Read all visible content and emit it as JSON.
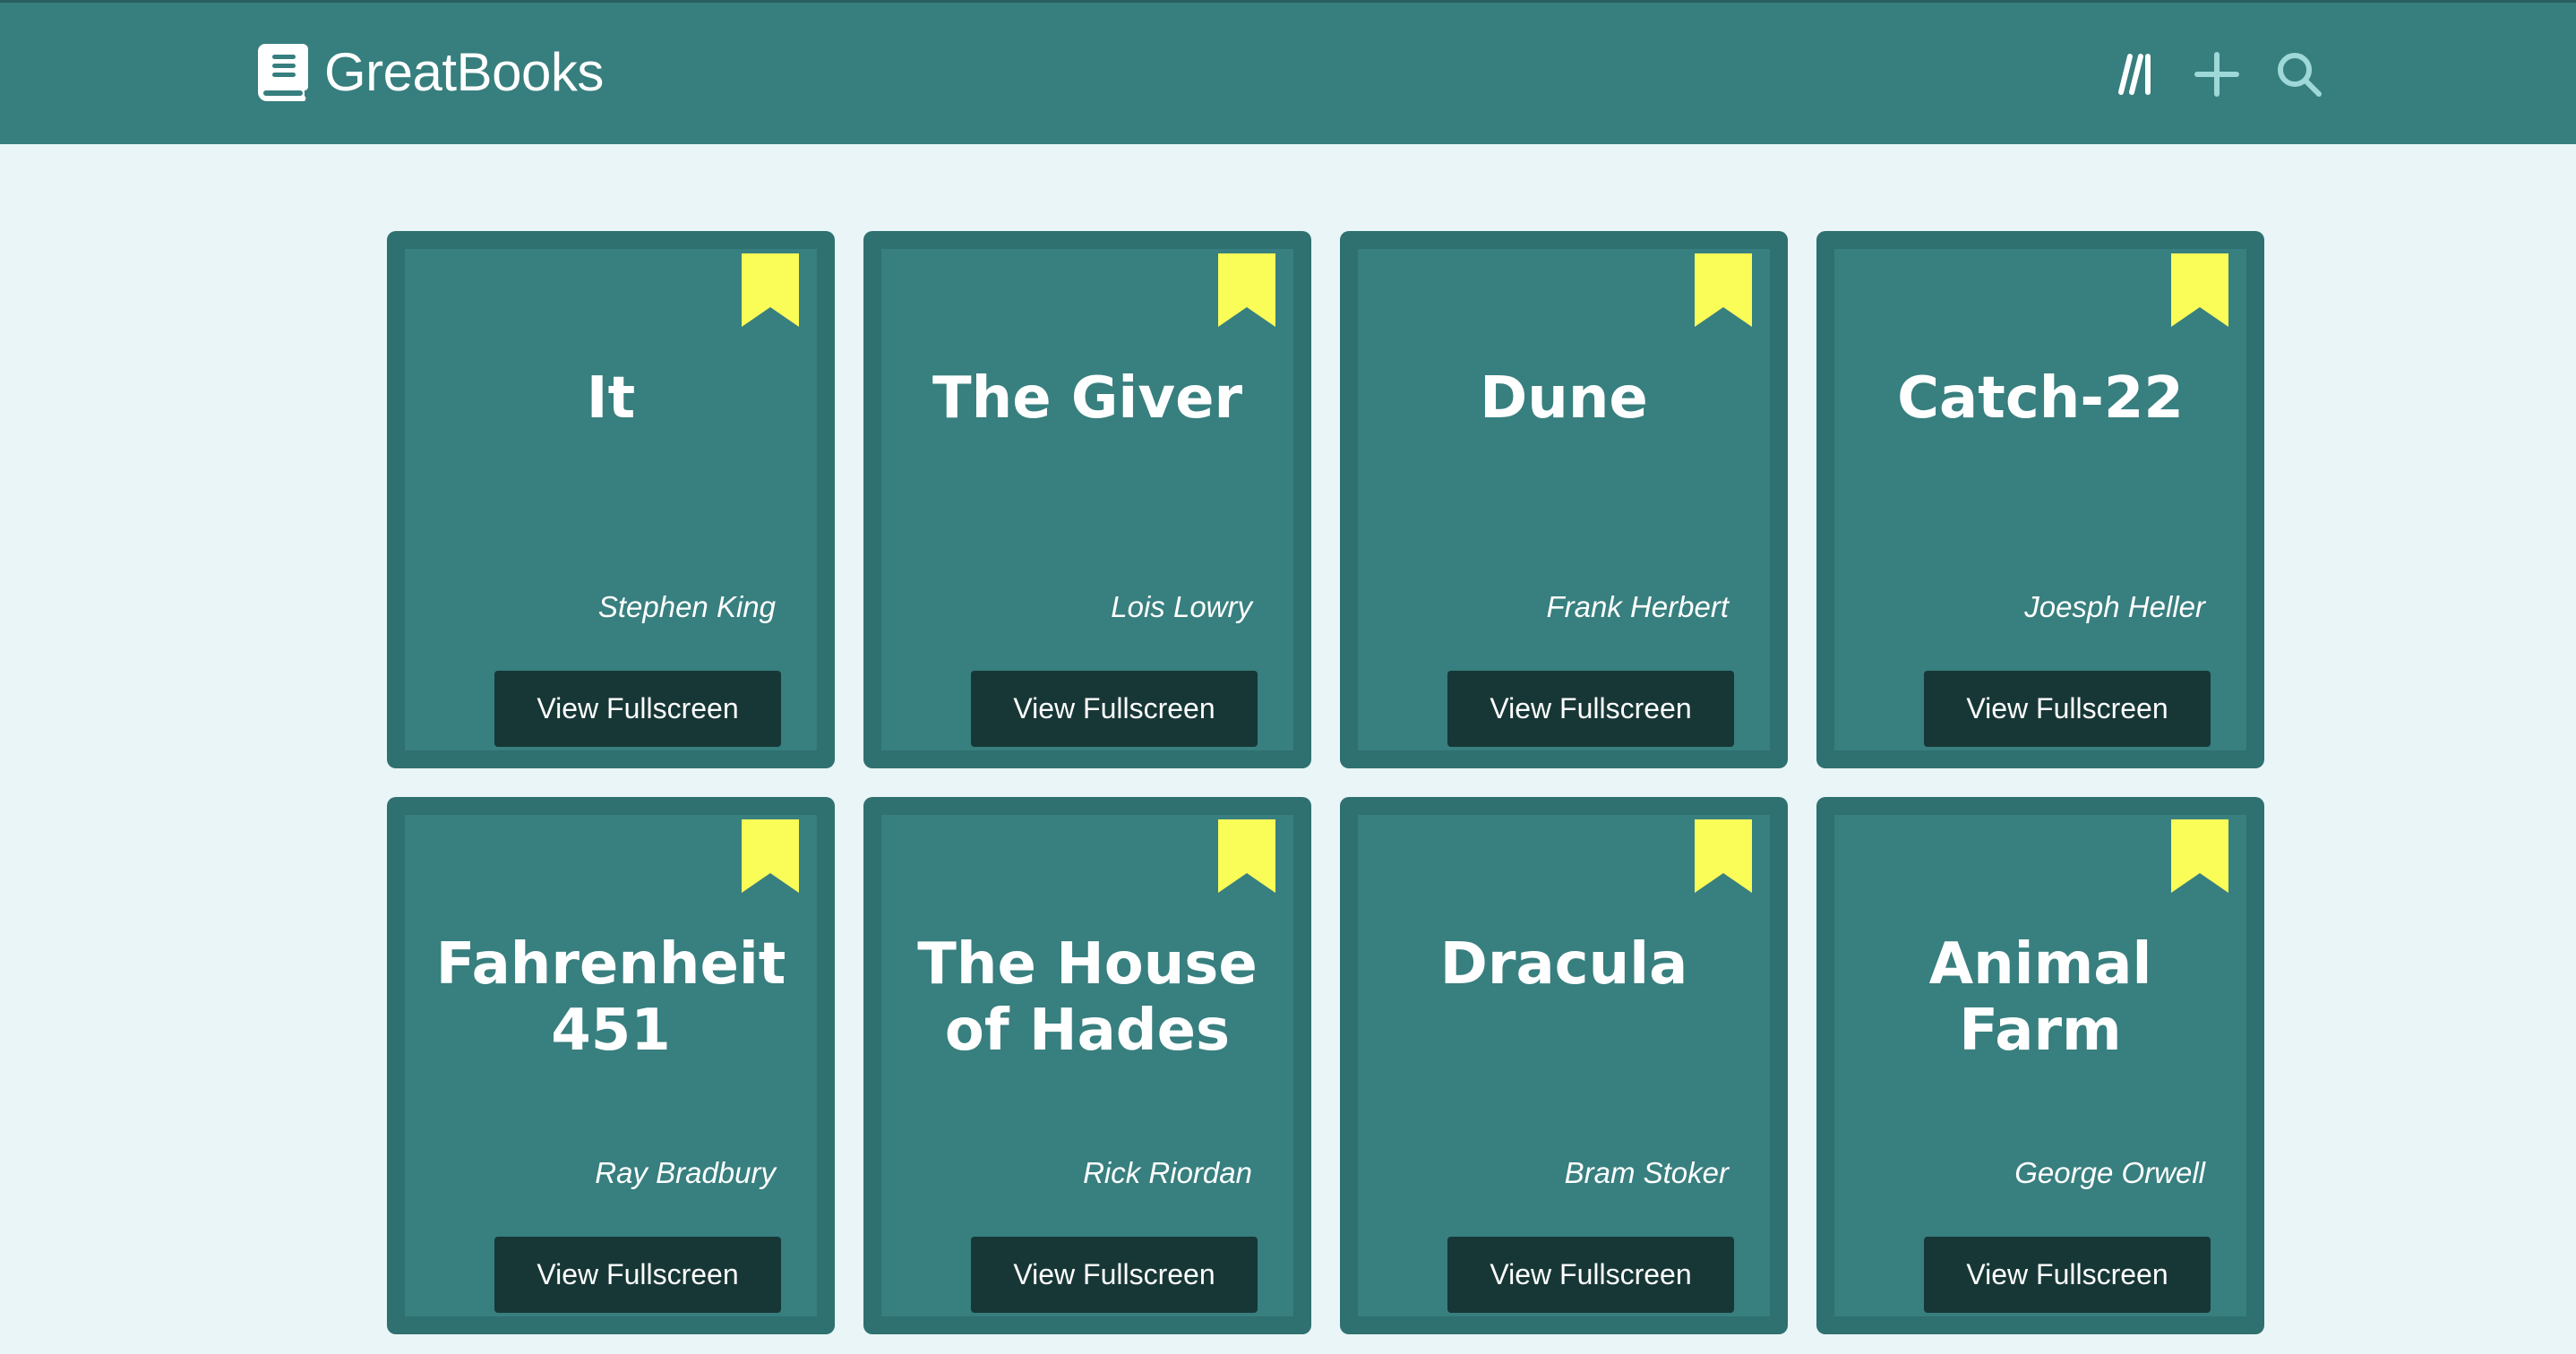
{
  "app": {
    "name": "GreatBooks",
    "icons": [
      "book-icon",
      "library-icon",
      "plus-icon",
      "search-icon"
    ]
  },
  "colors": {
    "navbar": "#377e7e",
    "page_background": "#e9f5f6",
    "card_border": "#2f7071",
    "card_face": "#387f7f",
    "bookmark": "#fafc58",
    "button": "#173736",
    "nav_icon_accent": "#9ed8d9"
  },
  "button_label": "View Fullscreen",
  "books": [
    {
      "title": "It",
      "author": "Stephen King"
    },
    {
      "title": "The Giver",
      "author": "Lois Lowry"
    },
    {
      "title": "Dune",
      "author": "Frank Herbert"
    },
    {
      "title": "Catch-22",
      "author": "Joesph Heller"
    },
    {
      "title": "Fahrenheit 451",
      "author": "Ray Bradbury"
    },
    {
      "title": "The House of Hades",
      "author": "Rick Riordan"
    },
    {
      "title": "Dracula",
      "author": "Bram Stoker"
    },
    {
      "title": "Animal Farm",
      "author": "George Orwell"
    }
  ]
}
